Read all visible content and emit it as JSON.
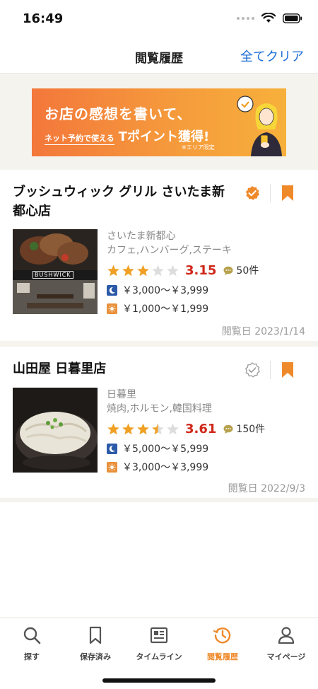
{
  "status": {
    "time": "16:49"
  },
  "nav": {
    "title": "閲覧履歴",
    "clear_label": "全てクリア"
  },
  "banner": {
    "line1": "お店の感想を書いて、",
    "line2_small": "ネット予約で使える",
    "line2_big": "Tポイント獲得!",
    "note": "※エリア限定"
  },
  "shops": [
    {
      "name": "ブッシュウィック グリル さいたま新都心店",
      "area": "さいたま新都心",
      "genre": "カフェ,ハンバーグ,ステーキ",
      "rating": 3.15,
      "rating_text": "3.15",
      "reviews": "50件",
      "dinner_price": "￥3,000～￥3,999",
      "lunch_price": "￥1,000～￥1,999",
      "viewed": "閲覧日 2023/1/14",
      "visited_checked": true,
      "thumb_sign": "BUSHWICK"
    },
    {
      "name": "山田屋 日暮里店",
      "area": "日暮里",
      "genre": "焼肉,ホルモン,韓国料理",
      "rating": 3.61,
      "rating_text": "3.61",
      "reviews": "150件",
      "dinner_price": "￥5,000～￥5,999",
      "lunch_price": "￥3,000～￥3,999",
      "viewed": "閲覧日 2022/9/3",
      "visited_checked": false
    }
  ],
  "tabs": [
    {
      "label": "探す",
      "icon": "search-icon"
    },
    {
      "label": "保存済み",
      "icon": "bookmark-icon"
    },
    {
      "label": "タイムライン",
      "icon": "timeline-icon"
    },
    {
      "label": "閲覧履歴",
      "icon": "history-icon",
      "active": true
    },
    {
      "label": "マイページ",
      "icon": "person-icon"
    }
  ],
  "colors": {
    "accent": "#ef8a2b",
    "link": "#1e6fd6",
    "score": "#d0281b",
    "star": "#f0a024",
    "star_empty": "#dddddd"
  }
}
